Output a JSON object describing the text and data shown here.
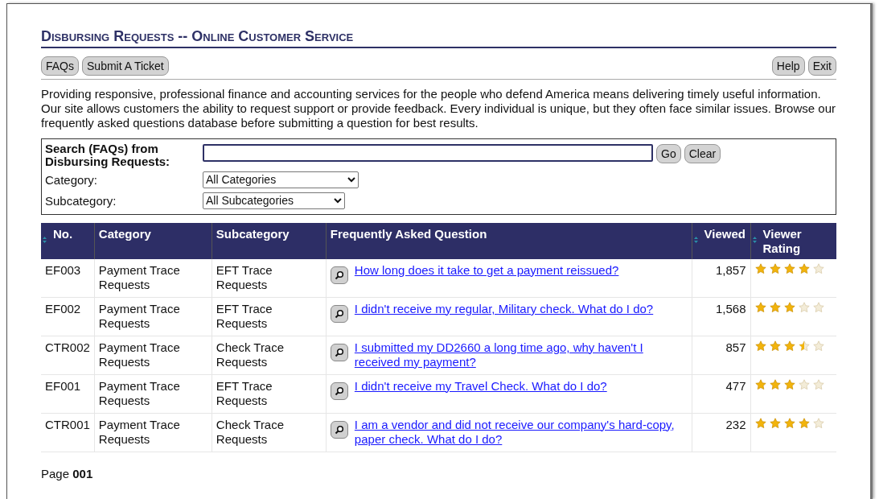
{
  "title": "Disbursing Requests -- Online Customer Service",
  "nav_left": [
    "FAQs",
    "Submit A Ticket"
  ],
  "nav_right": [
    "Help",
    "Exit"
  ],
  "intro": "Providing responsive, professional finance and accounting services for the people who defend America means delivering timely useful information. Our site allows customers the ability to request support or provide feedback. Every individual is unique, but they often face similar issues. Browse our frequently asked questions database before submitting a question for best results.",
  "search": {
    "label": "Search (FAQs) from Disbursing Requests:",
    "go": "Go",
    "clear": "Clear",
    "category_label": "Category:",
    "category": "All Categories",
    "subcategory_label": "Subcategory:",
    "subcategory": "All Subcategories"
  },
  "table": {
    "columns": [
      {
        "label": "No.",
        "sortable": true
      },
      {
        "label": "Category",
        "sortable": false
      },
      {
        "label": "Subcategory",
        "sortable": false
      },
      {
        "label": "Frequently Asked Question",
        "sortable": false
      },
      {
        "label": "Viewed",
        "sortable": true
      },
      {
        "label": "Viewer Rating",
        "sortable": true
      }
    ],
    "rows": [
      {
        "no": "EF003",
        "category": "Payment Trace Requests",
        "subcategory": "EFT Trace Requests",
        "question": "How long does it take to get a payment reissued?",
        "viewed": "1,857",
        "stars": 4
      },
      {
        "no": "EF002",
        "category": "Payment Trace Requests",
        "subcategory": "EFT Trace Requests",
        "question": "I didn't receive my regular, Military check. What do I do?",
        "viewed": "1,568",
        "stars": 3
      },
      {
        "no": "CTR002",
        "category": "Payment Trace Requests",
        "subcategory": "Check Trace Requests",
        "question": "I submitted my DD2660 a long time ago, why haven't I received my payment?",
        "viewed": "857",
        "stars": 3.5
      },
      {
        "no": "EF001",
        "category": "Payment Trace Requests",
        "subcategory": "EFT Trace Requests",
        "question": "I didn't receive my Travel Check. What do I do?",
        "viewed": "477",
        "stars": 3
      },
      {
        "no": "CTR001",
        "category": "Payment Trace Requests",
        "subcategory": "Check Trace Requests",
        "question": "I am a vendor and did not receive our company's hard-copy, paper check. What do I do?",
        "viewed": "232",
        "stars": 4
      }
    ]
  },
  "page_label": "Page",
  "page_number": "001"
}
